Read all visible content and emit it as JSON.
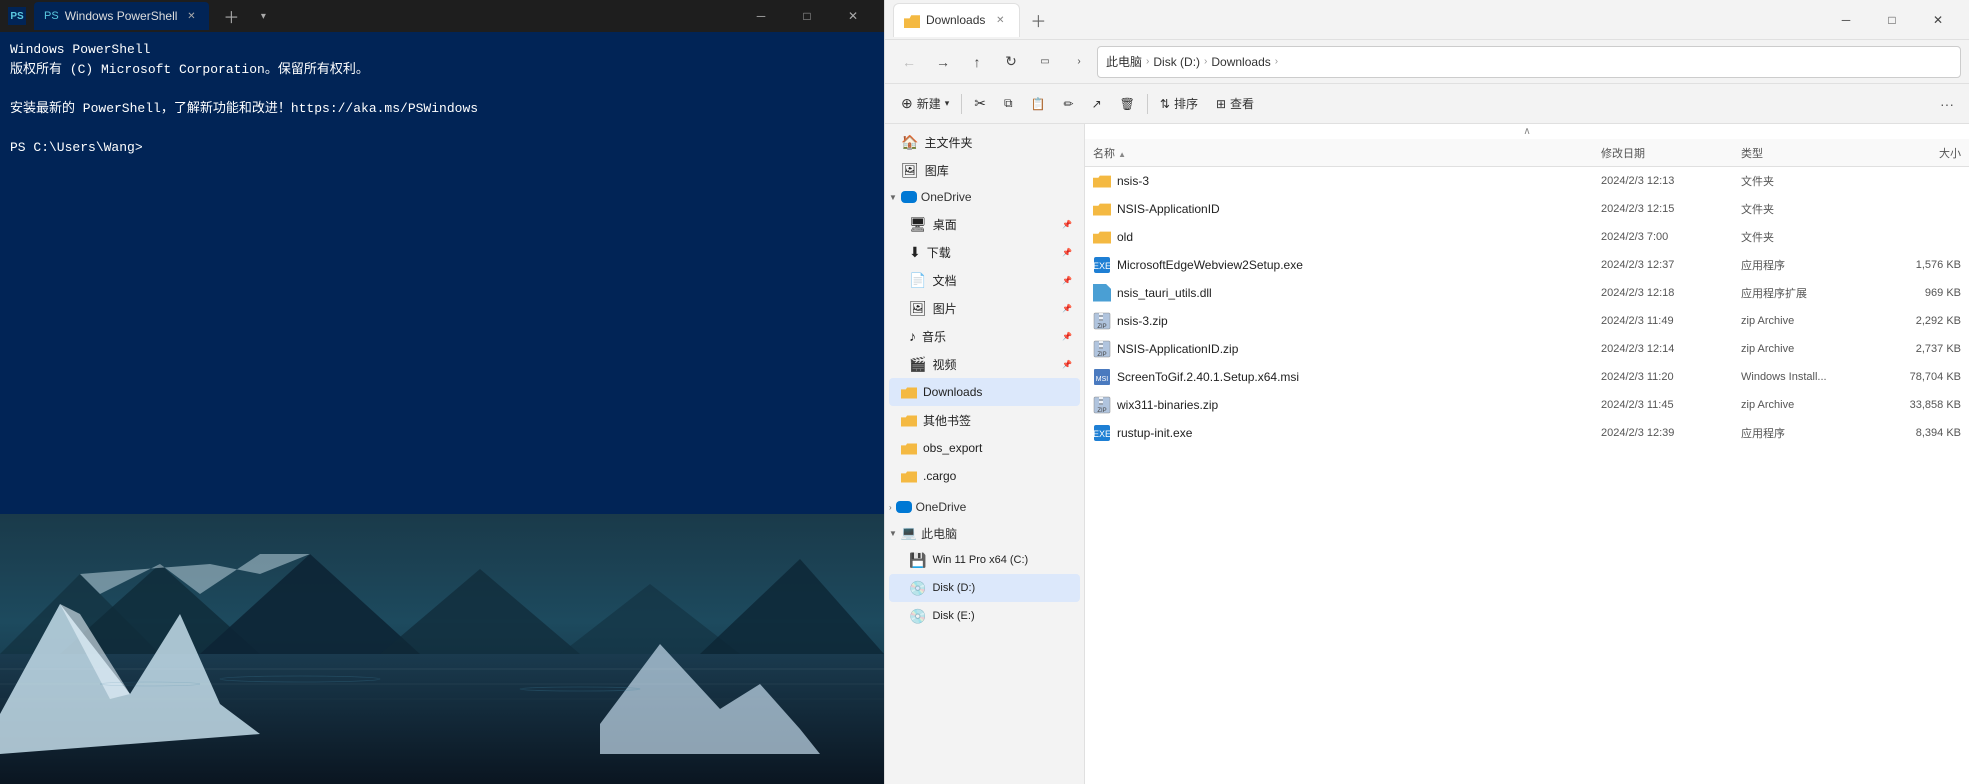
{
  "powershell": {
    "title": "Windows PowerShell",
    "tab_label": "Windows PowerShell",
    "content_lines": [
      "Windows PowerShell",
      "版权所有 (C)  Microsoft Corporation。保留所有权利。",
      "",
      "安装最新的 PowerShell，了解新功能和改进！https://aka.ms/PSWindows",
      "",
      "PS C:\\Users\\Wang>"
    ]
  },
  "explorer": {
    "title": "Downloads",
    "tab_label": "Downloads",
    "address": {
      "parts": [
        "此电脑",
        "Disk (D:)",
        "Downloads"
      ]
    },
    "new_button": "新建",
    "commands": {
      "cut": "✂",
      "copy": "⧉",
      "paste": "📋",
      "rename": "✏",
      "share": "↗",
      "delete": "🗑",
      "sort": "排序",
      "view": "查看",
      "more": "···"
    },
    "sidebar": {
      "items": [
        {
          "id": "home",
          "label": "主文件夹",
          "type": "home",
          "indent": 1
        },
        {
          "id": "library",
          "label": "图库",
          "type": "library",
          "indent": 1
        },
        {
          "id": "onedrive-header",
          "label": "OneDrive",
          "type": "section-expand",
          "indent": 0
        },
        {
          "id": "desktop",
          "label": "桌面",
          "type": "folder-pin",
          "indent": 2
        },
        {
          "id": "downloads",
          "label": "下载",
          "type": "folder-pin",
          "indent": 2
        },
        {
          "id": "documents",
          "label": "文档",
          "type": "folder-pin",
          "indent": 2
        },
        {
          "id": "pictures",
          "label": "图片",
          "type": "folder-pin",
          "indent": 2
        },
        {
          "id": "music",
          "label": "音乐",
          "type": "folder-pin",
          "indent": 2
        },
        {
          "id": "videos",
          "label": "视频",
          "type": "folder-pin",
          "indent": 2
        },
        {
          "id": "downloads-folder",
          "label": "Downloads",
          "type": "folder-active",
          "indent": 1
        },
        {
          "id": "other-bookmarks",
          "label": "其他书签",
          "type": "folder",
          "indent": 1
        },
        {
          "id": "obs-export",
          "label": "obs_export",
          "type": "folder",
          "indent": 1
        },
        {
          "id": "cargo",
          "label": ".cargo",
          "type": "folder",
          "indent": 1
        },
        {
          "id": "onedrive-section",
          "label": "OneDrive",
          "type": "section-cloud",
          "indent": 0
        },
        {
          "id": "this-pc",
          "label": "此电脑",
          "type": "section-expand-active",
          "indent": 0
        },
        {
          "id": "win11",
          "label": "Win 11 Pro x64 (C:)",
          "type": "drive-c",
          "indent": 1
        },
        {
          "id": "disk-d",
          "label": "Disk (D:)",
          "type": "drive-d-active",
          "indent": 1
        },
        {
          "id": "disk-e",
          "label": "Disk (E:)",
          "type": "drive-e",
          "indent": 1
        }
      ]
    },
    "file_list": {
      "headers": [
        "名称",
        "修改日期",
        "类型",
        "大小"
      ],
      "files": [
        {
          "name": "nsis-3",
          "date": "2024/2/3 12:13",
          "type": "文件夹",
          "size": "",
          "icon": "folder"
        },
        {
          "name": "NSIS-ApplicationID",
          "date": "2024/2/3 12:15",
          "type": "文件夹",
          "size": "",
          "icon": "folder"
        },
        {
          "name": "old",
          "date": "2024/2/3 7:00",
          "type": "文件夹",
          "size": "",
          "icon": "folder"
        },
        {
          "name": "MicrosoftEdgeWebview2Setup.exe",
          "date": "2024/2/3 12:37",
          "type": "应用程序",
          "size": "1,576 KB",
          "icon": "exe"
        },
        {
          "name": "nsis_tauri_utils.dll",
          "date": "2024/2/3 12:18",
          "type": "应用程序扩展",
          "size": "969 KB",
          "icon": "dll"
        },
        {
          "name": "nsis-3.zip",
          "date": "2024/2/3 11:49",
          "type": "zip Archive",
          "size": "2,292 KB",
          "icon": "zip"
        },
        {
          "name": "NSIS-ApplicationID.zip",
          "date": "2024/2/3 12:14",
          "type": "zip Archive",
          "size": "2,737 KB",
          "icon": "zip"
        },
        {
          "name": "ScreenToGif.2.40.1.Setup.x64.msi",
          "date": "2024/2/3 11:20",
          "type": "Windows Install...",
          "size": "78,704 KB",
          "icon": "msi"
        },
        {
          "name": "wix311-binaries.zip",
          "date": "2024/2/3 11:45",
          "type": "zip Archive",
          "size": "33,858 KB",
          "icon": "zip"
        },
        {
          "name": "rustup-init.exe",
          "date": "2024/2/3 12:39",
          "type": "应用程序",
          "size": "8,394 KB",
          "icon": "exe"
        }
      ]
    }
  }
}
